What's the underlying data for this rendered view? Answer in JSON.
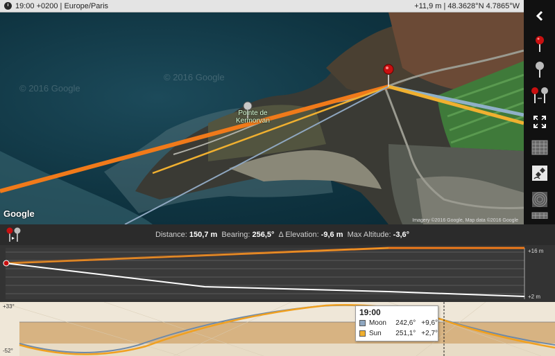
{
  "topbar": {
    "time_zone": "19:00 +0200 | Europe/Paris",
    "position": "+11,9 m | 48.3628°N 4.7865°W"
  },
  "map": {
    "place_label_line1": "Pointe de",
    "place_label_line2": "Kermorvan",
    "watermark_1": "© 2016 Google",
    "watermark_2": "© 2016 Google",
    "google_logo": "Google",
    "attribution": "Imagery ©2016 Google, Map data ©2016 Google"
  },
  "toolbar": {
    "icons": [
      "back-arrow-icon",
      "red-pin-icon",
      "grey-pin-icon",
      "pins-distance-icon",
      "fullscreen-icon",
      "grid-icon",
      "satellite-icon",
      "terrain-icon",
      "layer-icon"
    ]
  },
  "info": {
    "distance_label": "Distance:",
    "distance_value": "150,7 m",
    "bearing_label": "Bearing:",
    "bearing_value": "256,5°",
    "elevation_label": "Δ Elevation:",
    "elevation_value": "-9,6 m",
    "max_alt_label": "Max Altitude:",
    "max_alt_value": "-3,6°"
  },
  "profile": {
    "top_label": "+16 m",
    "bottom_label": "+2 m"
  },
  "sunmoon": {
    "top_label": "+33°",
    "bottom_label": "-52°",
    "legend_time": "19:00",
    "moon_name": "Moon",
    "moon_azimuth": "242,6°",
    "moon_elevation": "+9,6°",
    "sun_name": "Sun",
    "sun_azimuth": "251,1°",
    "sun_elevation": "+2,7°"
  },
  "colors": {
    "sun_line": "#f07a1a",
    "sun_gold": "#f0b030",
    "moon_line": "#8fa7c0",
    "pin_red": "#c81010"
  }
}
